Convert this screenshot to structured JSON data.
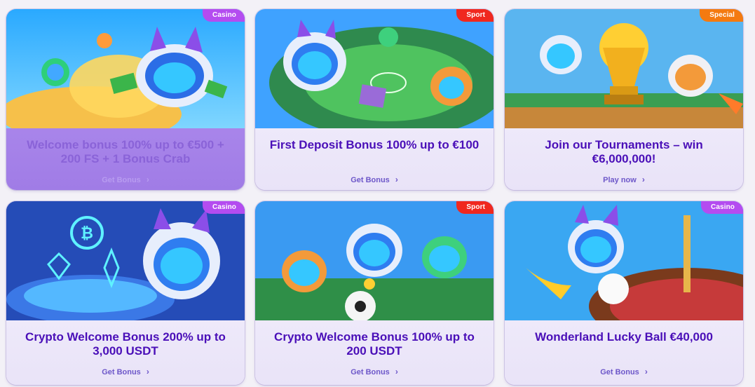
{
  "cards": [
    {
      "tag": "Casino",
      "title": "Welcome bonus 100% up to €500 + 200 FS + 1 Bonus Crab",
      "action": "Get Bonus"
    },
    {
      "tag": "Sport",
      "title": "First Deposit Bonus 100% up to €100",
      "action": "Get Bonus"
    },
    {
      "tag": "Special",
      "title": "Join our Tournaments – win €6,000,000!",
      "action": "Play now"
    },
    {
      "tag": "Casino",
      "title": "Crypto Welcome Bonus 200% up to 3,000 USDT",
      "action": "Get Bonus"
    },
    {
      "tag": "Sport",
      "title": "Crypto Welcome Bonus 100% up to 200 USDT",
      "action": "Get Bonus"
    },
    {
      "tag": "Casino",
      "title": "Wonderland Lucky Ball €40,000",
      "action": "Get Bonus"
    }
  ],
  "icons": {
    "chevron": "chevron-right-icon"
  },
  "colors": {
    "casino": "#b44cf0",
    "sport": "#f0281f",
    "special": "#f47a10",
    "title": "#4a0fb8",
    "link": "#6d57c9"
  }
}
